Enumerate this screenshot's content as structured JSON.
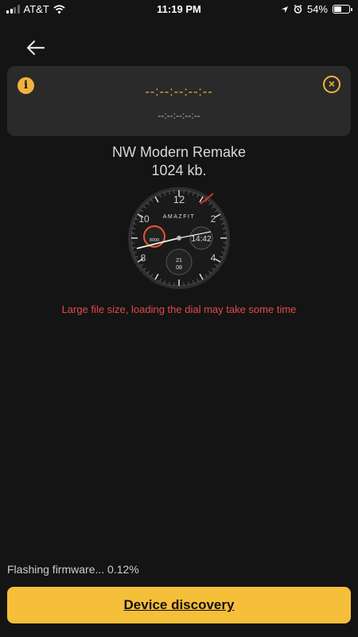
{
  "status_bar": {
    "carrier": "AT&T",
    "time": "11:19 PM",
    "battery": "54%",
    "battery_level": 0.54
  },
  "notice": {
    "primary_time": "--:--:--:--:--",
    "secondary_time": "--:--:--:--:--"
  },
  "watch_face": {
    "name": "NW Modern Remake",
    "size": "1024 kb.",
    "brand": "AMAZFIT",
    "digital_time": "14:42",
    "steps": "8000",
    "date_day": "21",
    "date_month": "08",
    "numerals": [
      "12",
      "2",
      "4",
      "8",
      "10"
    ]
  },
  "warning": "Large file size, loading the dial may take some time",
  "progress": {
    "label": "Flashing firmware... 0.12%"
  },
  "discovery_button": {
    "label": "Device discovery"
  },
  "colors": {
    "accent": "#f6bf3a",
    "warning": "#e04a4a",
    "background": "#141414",
    "card": "#2a2a2a"
  }
}
